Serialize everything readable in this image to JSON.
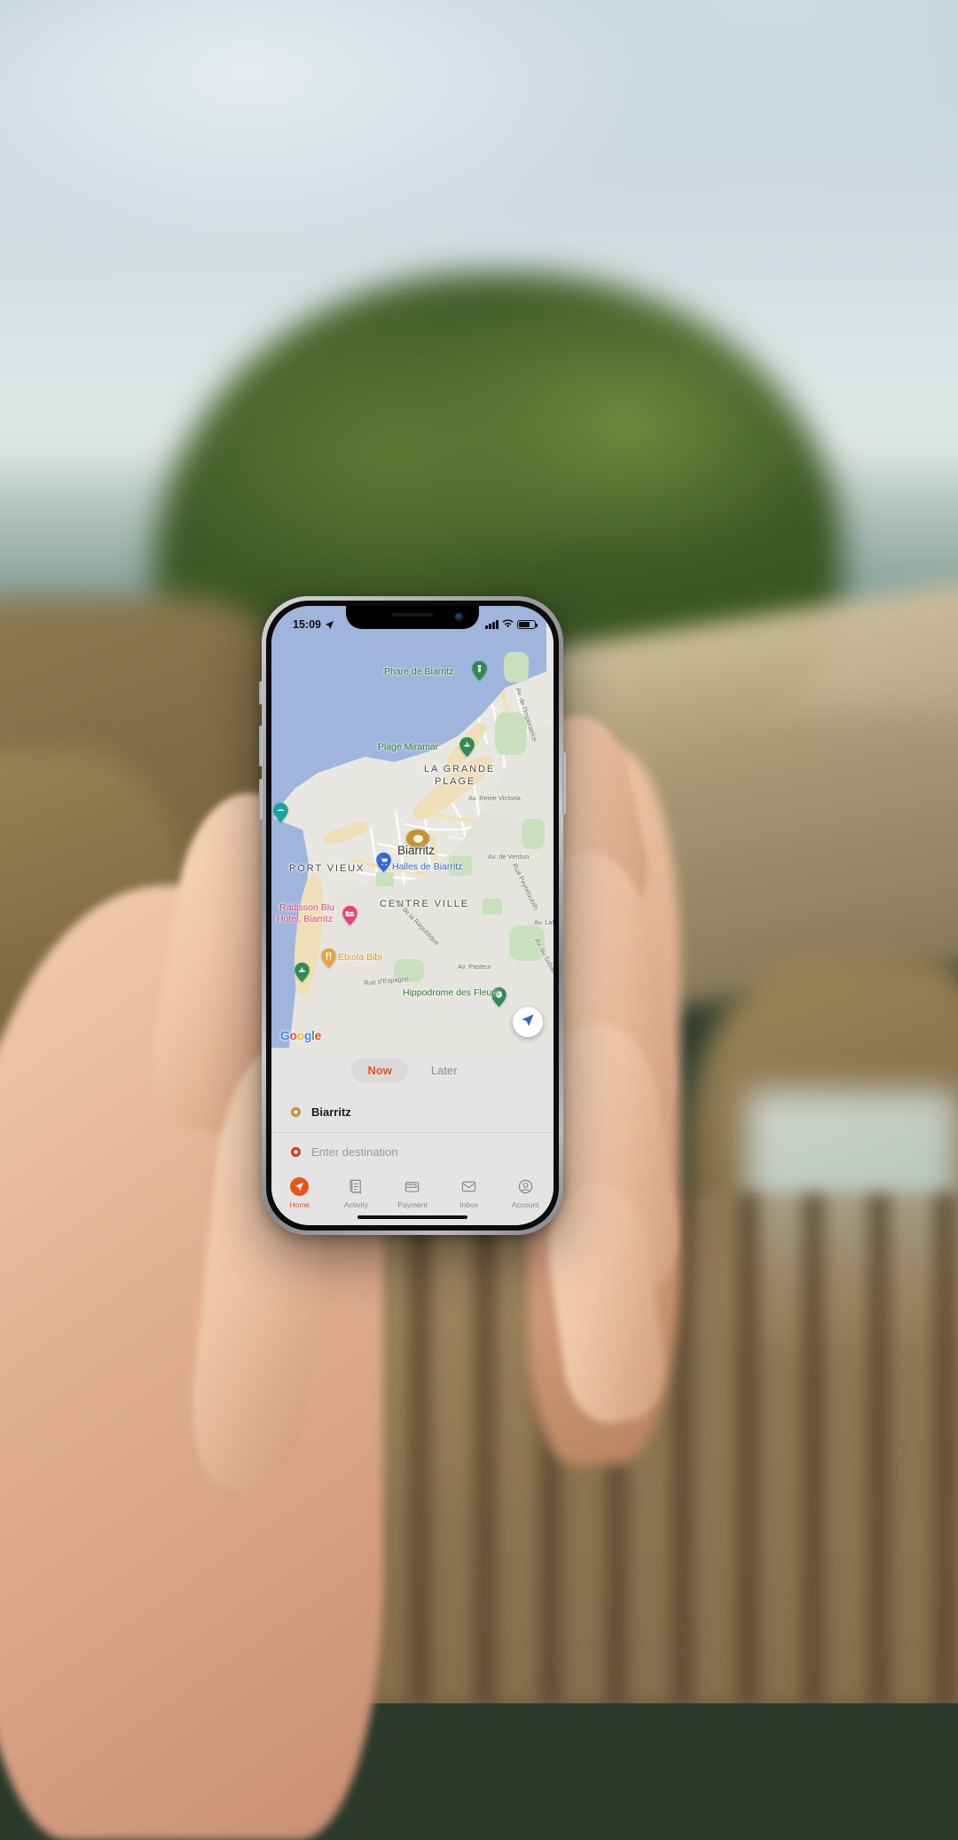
{
  "status_bar": {
    "time": "15:09",
    "location_icon": "location-arrow-icon",
    "signal_icon": "cellular-signal-icon",
    "wifi_icon": "wifi-icon",
    "battery_icon": "battery-icon"
  },
  "map": {
    "attribution": "Google",
    "attribution_letters": [
      "G",
      "o",
      "o",
      "g",
      "l",
      "e"
    ],
    "locate_button_icon": "navigate-locate-icon",
    "city_marker": "Biarritz",
    "labels": [
      {
        "text": "Phare de Biarritz",
        "kind": "park"
      },
      {
        "text": "Plage Miramar",
        "kind": "park"
      },
      {
        "text": "LA GRANDE",
        "kind": "area"
      },
      {
        "text": "PLAGE",
        "kind": "area"
      },
      {
        "text": "Biarritz",
        "kind": "city"
      },
      {
        "text": "PORT VIEUX",
        "kind": "area"
      },
      {
        "text": "Halles de Biarritz",
        "kind": "shop"
      },
      {
        "text": "CENTRE VILLE",
        "kind": "area"
      },
      {
        "text": "Radisson Blu",
        "kind": "hotel"
      },
      {
        "text": "Hotel, Biarritz",
        "kind": "hotel"
      },
      {
        "text": "Etxola Bibi",
        "kind": "food"
      },
      {
        "text": "Hippodrome des Fleurs",
        "kind": "park"
      }
    ],
    "streets": [
      "Av. de l'Impératrice",
      "Av. Reine Victoria",
      "Av. de Verdun",
      "Rue Peyreloubilh",
      "Av. du Sabaou",
      "Av. de la République",
      "Av. Pasteur",
      "Rue d'Espagne",
      "Av. Lah"
    ],
    "pins": [
      {
        "name": "phare-de-biarritz-pin",
        "color": "#2e8b57",
        "icon": "lighthouse-icon"
      },
      {
        "name": "plage-miramar-pin",
        "color": "#2e8b57",
        "icon": "beach-icon"
      },
      {
        "name": "halles-de-biarritz-pin",
        "color": "#3367d6",
        "icon": "shopping-cart-icon"
      },
      {
        "name": "radisson-blu-pin",
        "color": "#e0467c",
        "icon": "bed-icon"
      },
      {
        "name": "etxola-bibi-pin",
        "color": "#e8a33d",
        "icon": "restaurant-icon"
      },
      {
        "name": "beach-south-pin",
        "color": "#2e8b57",
        "icon": "beach-icon"
      },
      {
        "name": "hippodrome-pin",
        "color": "#2e8b57",
        "icon": "park-icon"
      },
      {
        "name": "west-coast-pin",
        "color": "#1aa3a3",
        "icon": "water-icon"
      }
    ]
  },
  "sheet": {
    "segments": [
      {
        "label": "Now",
        "active": true
      },
      {
        "label": "Later",
        "active": false
      }
    ],
    "pickup": {
      "value": "Biarritz",
      "dot_color": "#c8922c"
    },
    "destination": {
      "placeholder": "Enter destination",
      "value": "",
      "dot_color": "#d4391c"
    }
  },
  "tabbar": {
    "accent": "#e8541c",
    "items": [
      {
        "label": "Home",
        "icon": "navigate-arrow-icon",
        "active": true
      },
      {
        "label": "Activity",
        "icon": "receipt-icon",
        "active": false
      },
      {
        "label": "Payment",
        "icon": "wallet-icon",
        "active": false
      },
      {
        "label": "Inbox",
        "icon": "envelope-icon",
        "active": false
      },
      {
        "label": "Account",
        "icon": "person-circle-icon",
        "active": false
      }
    ]
  }
}
